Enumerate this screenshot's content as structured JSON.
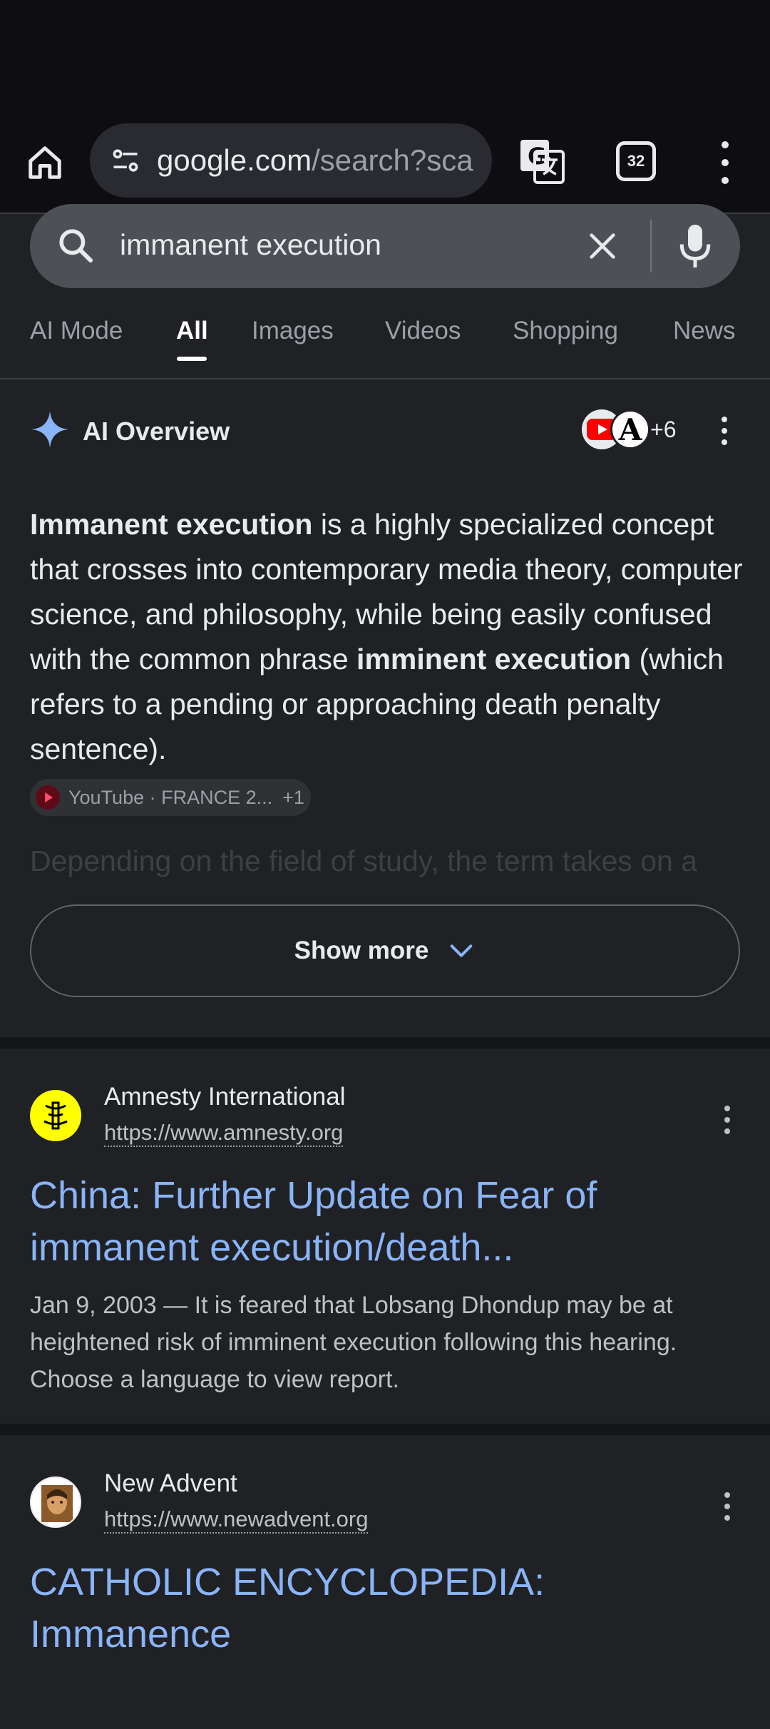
{
  "browser": {
    "url_host": "google.com",
    "url_path": "/search?sca",
    "tab_count": "32"
  },
  "search": {
    "query": "immanent execution"
  },
  "tabs": [
    {
      "label": "AI Mode"
    },
    {
      "label": "All"
    },
    {
      "label": "Images"
    },
    {
      "label": "Videos"
    },
    {
      "label": "Shopping"
    },
    {
      "label": "News"
    }
  ],
  "ai_overview": {
    "title": "AI Overview",
    "source_count": "+6",
    "body": {
      "p1_bold1": "Immanent execution",
      "p1_text1": " is a highly specialized concept that crosses into contemporary media theory, computer science, and philosophy, while being easily confused with the common phrase ",
      "p1_bold2": "imminent execution",
      "p1_text2": " (which refers to a pending or approaching death penalty sentence)."
    },
    "chip": {
      "label": "YouTube · FRANCE 2...",
      "extra": "+1"
    },
    "faded_text": "Depending on the field of study, the term takes on a",
    "show_more": "Show more"
  },
  "results": [
    {
      "site": "Amnesty International",
      "url": "https://www.amnesty.org",
      "title": "China: Further Update on Fear of immanent execution/death...",
      "snippet": "Jan 9, 2003 — It is feared that Lobsang Dhondup may be at heightened risk of imminent execution following this hearing. Choose a language to view report."
    },
    {
      "site": "New Advent",
      "url": "https://www.newadvent.org",
      "title": "CATHOLIC ENCYCLOPEDIA: Immanence"
    }
  ],
  "colors": {
    "background": "#202124",
    "link": "#8ab4f8",
    "accent_spark": "#8ab4f8",
    "amnesty_yellow": "#ffff00"
  }
}
